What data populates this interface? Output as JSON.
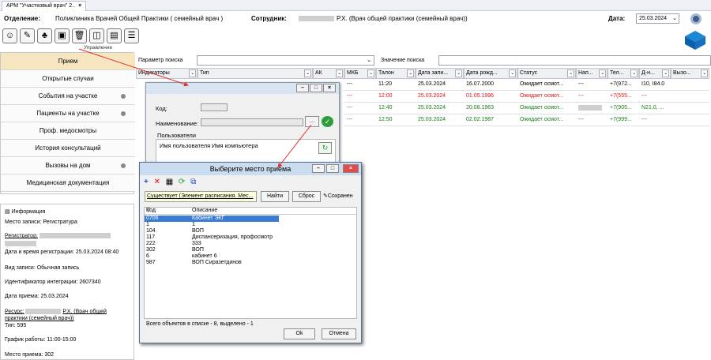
{
  "tab": {
    "title": "АРМ \"Участковый врач\" 2..",
    "close": "×"
  },
  "header": {
    "dept_label": "Отделение:",
    "dept_value": "Поликлиника Врачей Общей Практики ( семейный врач )",
    "employee_label": "Сотрудник:",
    "employee_value": "Р.Х. (Врач общей практики (семейный врач))",
    "date_label": "Дата:",
    "date_value": "25.03.2024"
  },
  "toolbar": {
    "label": "Управление"
  },
  "sidebar": {
    "items": [
      {
        "label": "Прием"
      },
      {
        "label": "Открытые случаи"
      },
      {
        "label": "События на участке"
      },
      {
        "label": "Пациенты на участке"
      },
      {
        "label": "Проф. медосмотры"
      },
      {
        "label": "История консультаций"
      },
      {
        "label": "Вызовы на дом"
      },
      {
        "label": "Медицинская документация"
      }
    ]
  },
  "info": {
    "title": "Информация",
    "place": "Место записи: Регистратура",
    "registrar_label": "Регистратор:",
    "reg_datetime": "Дата и время регистрации: 25.03.2024 08:40",
    "record_type": "Вид записи: Обычная запись",
    "integration_id": "Идентификатор интеграции: 2607340",
    "appointment_date": "Дата приема: 25.03.2024",
    "resource_label": "Ресурс:",
    "resource_value": "Р.Х. (Врач общей",
    "resource_value2": "практики (семейный врач))",
    "type": "Тип: 595",
    "schedule": "График работы: 11:00-15:00",
    "place_of_appt": "Место приема: 302"
  },
  "search": {
    "param_label": "Параметр поиска",
    "value_label": "Значение поиска"
  },
  "grid": {
    "headers": [
      "Индикаторы",
      "Тип",
      "АК",
      "МКБ",
      "Талон",
      "Дата запи...",
      "Дата рожд...",
      "Статус",
      "Нап...",
      "Тел...",
      "Д-н...",
      "Вызо..."
    ],
    "rows": [
      {
        "mkb": "---",
        "talon": "11:20",
        "date": "25.03.2024",
        "birth": "16.07.2000",
        "status": "Ожидает осмот...",
        "nap": "---",
        "tel": "+7(972...",
        "dn": "I10, I84.0",
        "color": "black"
      },
      {
        "mkb": "---",
        "talon": "12:00",
        "date": "25.03.2024",
        "birth": "01.05.1996",
        "status": "Ожидает осмот...",
        "nap": "---",
        "tel": "+7(555...",
        "dn": "---",
        "color": "red"
      },
      {
        "mkb": "---",
        "talon": "12:40",
        "date": "25.03.2024",
        "birth": "20.08.1963",
        "status": "Ожидает осмот...",
        "nap": "",
        "tel": "+7(905...",
        "dn": "N21.0, ...",
        "color": "green"
      },
      {
        "mkb": "---",
        "talon": "12:50",
        "date": "25.03.2024",
        "birth": "02.02.1987",
        "status": "Ожидает осмот...",
        "nap": "---",
        "tel": "+7(999...",
        "dn": "---",
        "color": "green"
      }
    ]
  },
  "dialog1": {
    "code_label": "Код:",
    "name_label": "Наименование:",
    "users_group": "Пользователи",
    "col_user": "Имя пользователя",
    "col_computer": "Имя компьютера"
  },
  "dialog2": {
    "title": "Выберите место приема",
    "filter": "Существует (Элемент расписания. Мес...",
    "find": "Найти",
    "reset": "Сброс",
    "save": "Сохранен",
    "col_code": "Код",
    "col_desc": "Описание",
    "rows": [
      {
        "code": "0706",
        "desc": "Кабинет ЭКГ"
      },
      {
        "code": "1",
        "desc": "1"
      },
      {
        "code": "104",
        "desc": "ВОП"
      },
      {
        "code": "117",
        "desc": "Диспансеризация, профосмотр"
      },
      {
        "code": "222",
        "desc": "333"
      },
      {
        "code": "302",
        "desc": "ВОП"
      },
      {
        "code": "6",
        "desc": "кабинет 6"
      },
      {
        "code": "987",
        "desc": "ВОП Сиразетдинов"
      }
    ],
    "status": "Всего объектов в списке - 8, выделено - 1",
    "ok": "Ok",
    "cancel": "Отмена"
  },
  "colors": {
    "selected_nav": "#f5e6c0",
    "selection": "#3a7bd5",
    "arrow": "#e03030"
  }
}
